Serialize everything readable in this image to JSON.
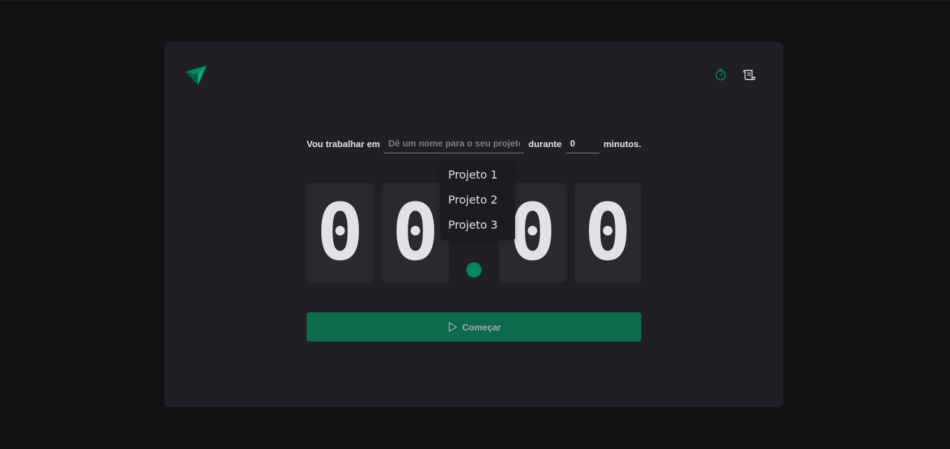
{
  "header": {
    "logo_icon": "ignite-logo-icon",
    "nav": [
      {
        "icon": "timer-icon",
        "active": true
      },
      {
        "icon": "scroll-history-icon",
        "active": false
      }
    ]
  },
  "form": {
    "prefix_label": "Vou trabalhar em",
    "task_placeholder": "Dê um nome para o seu projeto",
    "middle_label": "durante",
    "minutes_value": "0",
    "suffix_label": "minutos."
  },
  "suggestions": [
    "Projeto 1",
    "Projeto 2",
    "Projeto 3"
  ],
  "countdown": {
    "digits": [
      "0",
      "0",
      "0",
      "0"
    ],
    "separator": ":"
  },
  "start_button": {
    "label": "Começar",
    "icon": "play-icon"
  },
  "colors": {
    "accent": "#00875f",
    "button_bg": "#0b6b4c",
    "card_bg": "#202024",
    "page_bg": "#121214",
    "text": "#e1e1e6"
  }
}
